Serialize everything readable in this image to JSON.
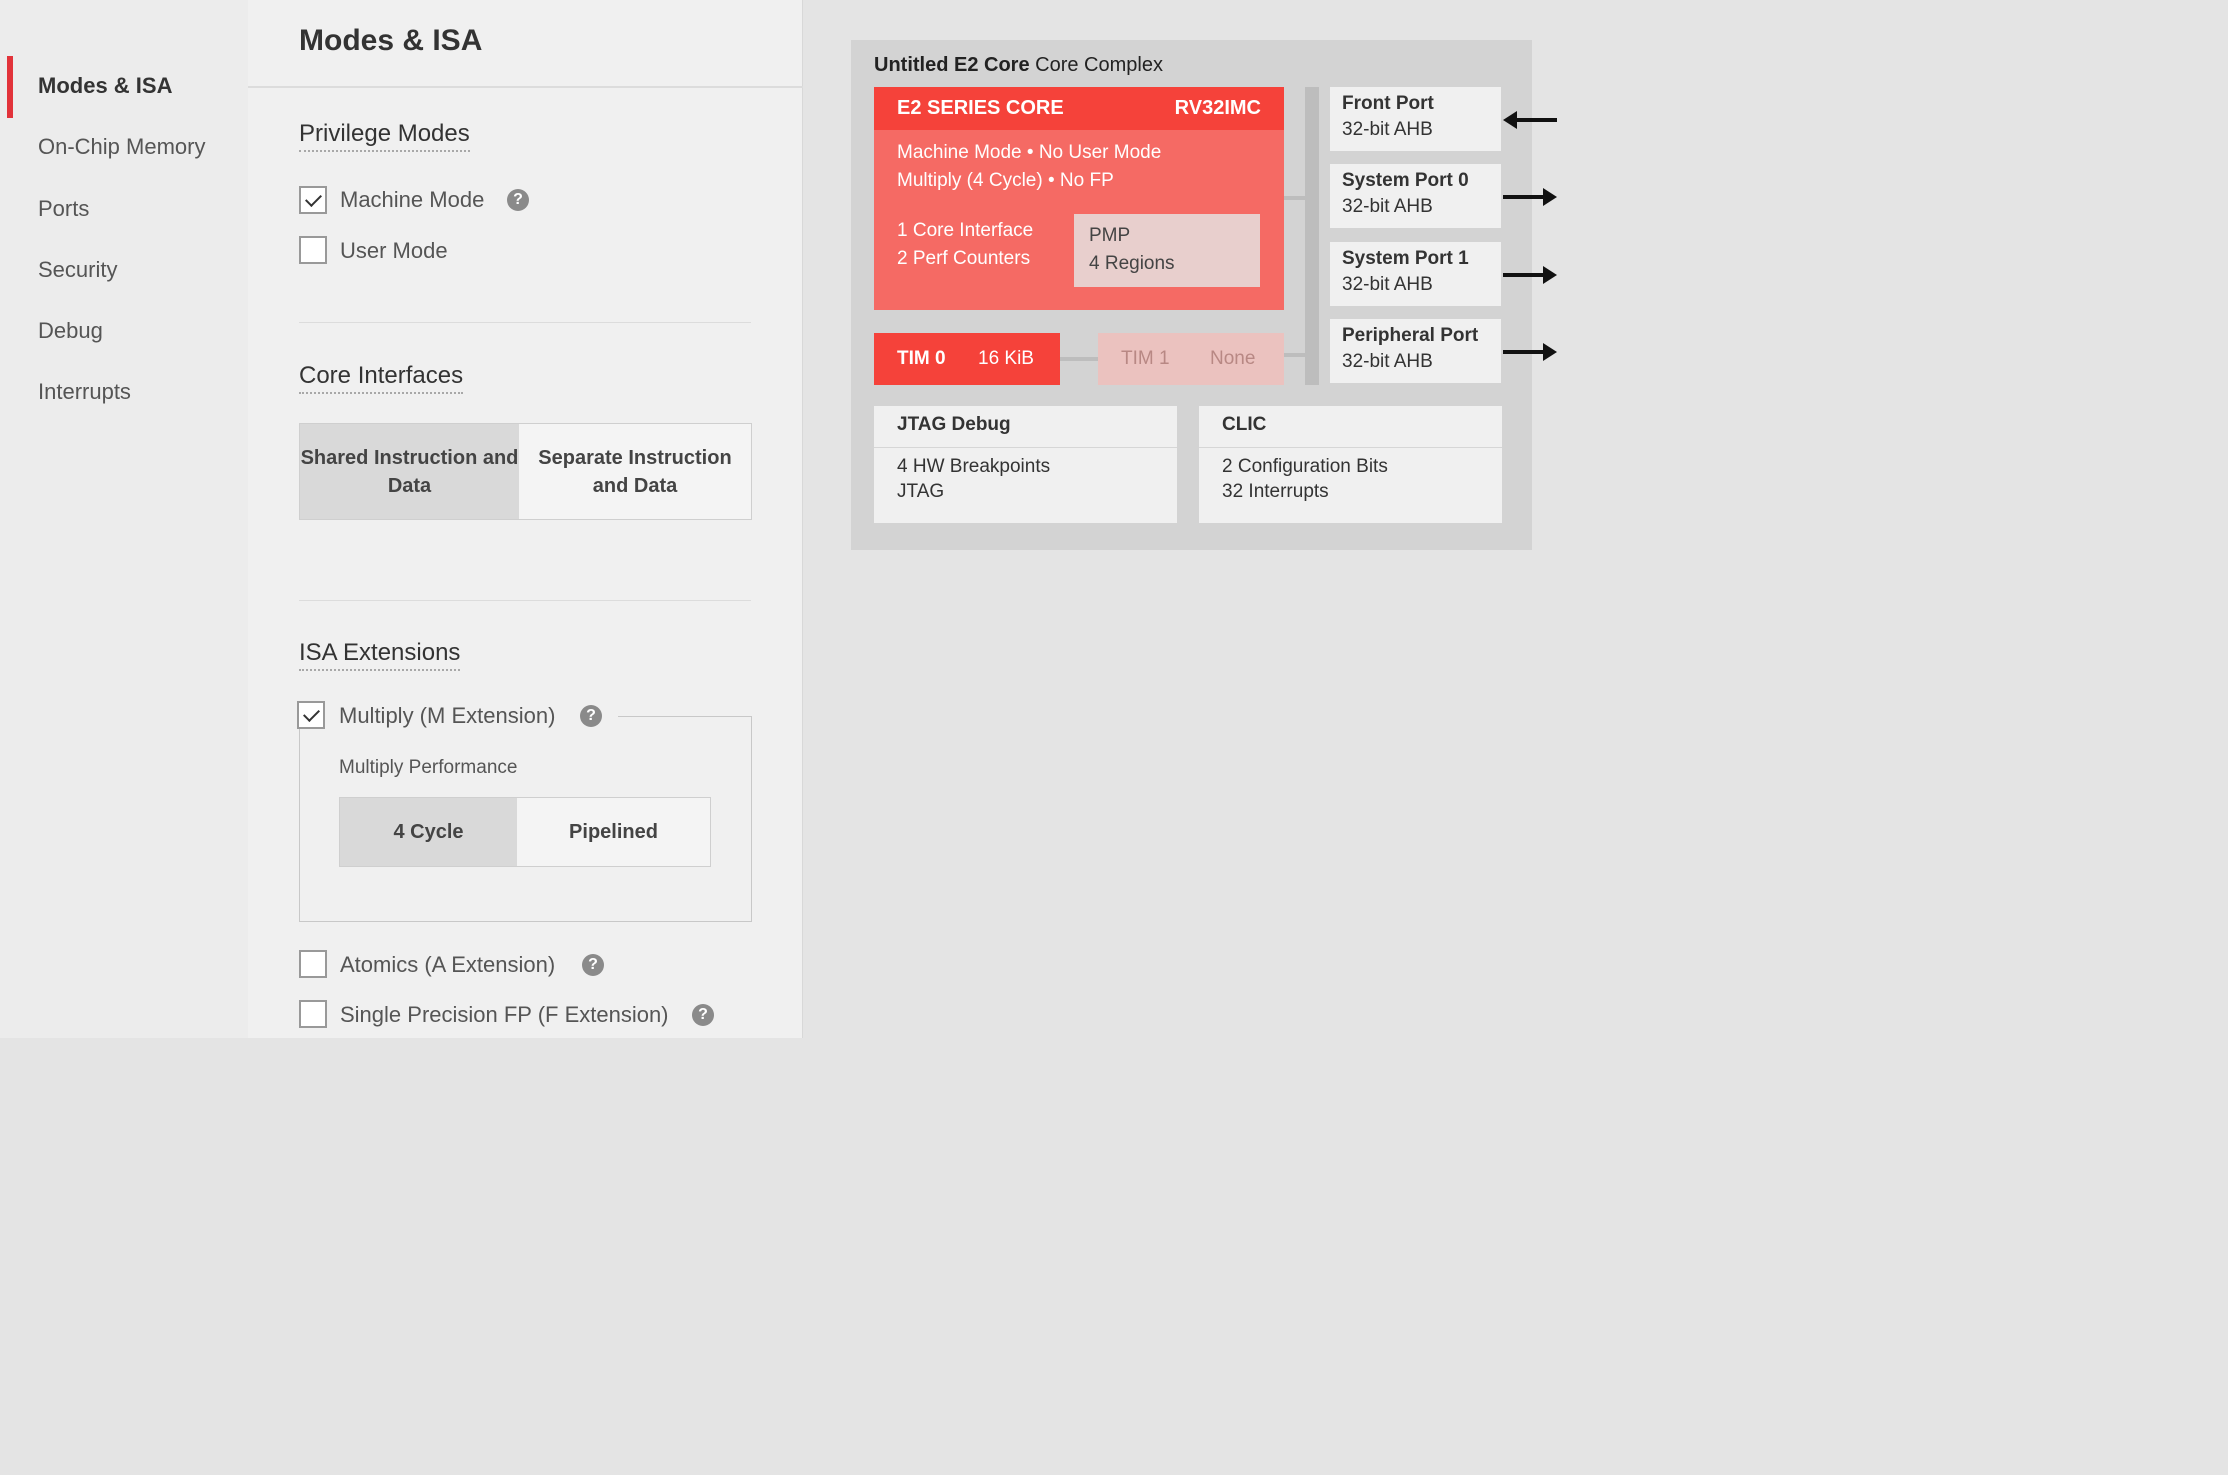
{
  "sidebar": {
    "items": [
      {
        "label": "Modes & ISA"
      },
      {
        "label": "On-Chip Memory"
      },
      {
        "label": "Ports"
      },
      {
        "label": "Security"
      },
      {
        "label": "Debug"
      },
      {
        "label": "Interrupts"
      }
    ]
  },
  "panel": {
    "title": "Modes & ISA",
    "privilege": {
      "title": "Privilege Modes",
      "machine": {
        "label": "Machine Mode",
        "checked": true
      },
      "user": {
        "label": "User Mode",
        "checked": false
      }
    },
    "interfaces": {
      "title": "Core Interfaces",
      "options": [
        "Shared Instruction and Data",
        "Separate Instruction and Data"
      ],
      "selected": "Shared Instruction and Data"
    },
    "isa": {
      "title": "ISA Extensions",
      "multiply": {
        "label": "Multiply (M Extension)",
        "checked": true
      },
      "perf": {
        "label": "Multiply Performance",
        "options": [
          "4 Cycle",
          "Pipelined"
        ],
        "selected": "4 Cycle"
      },
      "atomics": {
        "label": "Atomics (A Extension)",
        "checked": false
      },
      "fp": {
        "label": "Single Precision FP (F Extension)",
        "checked": false
      }
    },
    "help_glyph": "?"
  },
  "diagram": {
    "title_bold": "Untitled E2 Core",
    "title_rest": " Core Complex",
    "core": {
      "name": "E2 SERIES CORE",
      "isa": "RV32IMC",
      "line1": "Machine Mode • No User Mode",
      "line2": "Multiply (4 Cycle) • No FP",
      "line3": "1 Core Interface",
      "line4": "2 Perf Counters",
      "pmp_title": "PMP",
      "pmp_value": "4 Regions"
    },
    "tim0": {
      "name": "TIM 0",
      "size": "16 KiB"
    },
    "tim1": {
      "name": "TIM 1",
      "size": "None"
    },
    "ports": [
      {
        "name": "Front Port",
        "bus": "32-bit AHB",
        "direction": "in"
      },
      {
        "name": "System Port 0",
        "bus": "32-bit AHB",
        "direction": "out"
      },
      {
        "name": "System Port 1",
        "bus": "32-bit AHB",
        "direction": "out"
      },
      {
        "name": "Peripheral Port",
        "bus": "32-bit AHB",
        "direction": "out"
      }
    ],
    "jtag": {
      "title": "JTAG Debug",
      "line1": "4 HW Breakpoints",
      "line2": "JTAG"
    },
    "clic": {
      "title": "CLIC",
      "line1": "2 Configuration Bits",
      "line2": "32 Interrupts"
    },
    "colors": {
      "accent": "#f5423a",
      "core_body": "#f56a64",
      "tim_disabled": "#ebc2bf"
    }
  }
}
